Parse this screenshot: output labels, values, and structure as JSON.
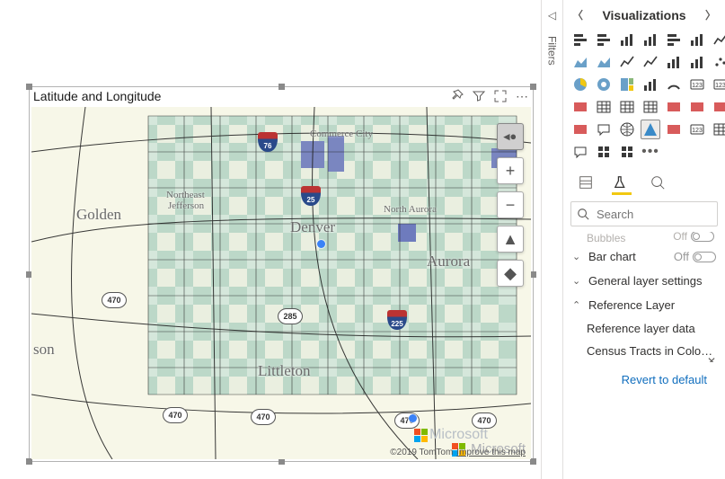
{
  "visual": {
    "title": "Latitude and Longitude",
    "attribution_prefix": "©2019 TomTom",
    "attribution_link": "Improve this map",
    "brand": "Microsoft"
  },
  "map": {
    "labels": {
      "denver": "Denver",
      "aurora": "Aurora",
      "golden": "Golden",
      "littleton": "Littleton",
      "commerce_city": "Commerce City",
      "north_aurora": "North Aurora",
      "ne_jefferson_1": "Northeast",
      "ne_jefferson_2": "Jefferson",
      "son_fragment": "son"
    },
    "shields": {
      "i76": "76",
      "i25": "25",
      "us285": "285",
      "i225": "225",
      "r470a": "470",
      "r470b": "470",
      "r470c": "470",
      "r470d": "470",
      "r470e": "470"
    }
  },
  "filters": {
    "rail_label": "Filters"
  },
  "vis_pane": {
    "title": "Visualizations",
    "search_placeholder": "Search",
    "peek_label": "Bubbles",
    "peek_state": "Off",
    "rows": {
      "bar_chart": "Bar chart",
      "bar_chart_state": "Off",
      "general": "General layer settings",
      "reference_layer": "Reference Layer"
    },
    "sub": {
      "ref_data": "Reference layer data",
      "census": "Census Tracts in Colorado..."
    },
    "revert": "Revert to default"
  },
  "icons": {
    "gallery": [
      "stacked-bar",
      "clustered-bar",
      "stacked-column",
      "clustered-column",
      "stacked-bar-100",
      "clustered-column-100",
      "line",
      "area",
      "stacked-area",
      "line-clustered",
      "line-stacked",
      "ribbon",
      "waterfall",
      "scatter",
      "pie",
      "donut",
      "treemap",
      "combo",
      "gauge",
      "card",
      "multi-card",
      "kpi",
      "slicer",
      "table",
      "matrix",
      "r-visual",
      "py-visual",
      "key-influencers",
      "decomp",
      "qna",
      "arcgis-map",
      "azure-map",
      "powerapps",
      "num-card",
      "paginated",
      "chat",
      "heatmap",
      "grid-visual",
      "more"
    ],
    "selected": "azure-map"
  }
}
